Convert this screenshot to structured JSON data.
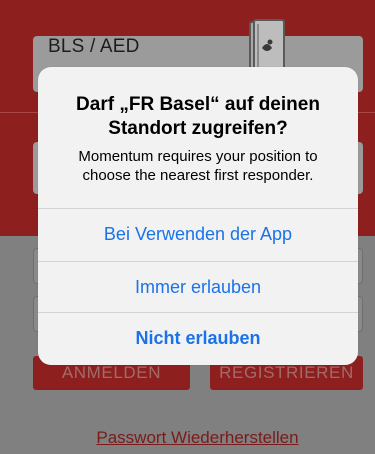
{
  "background": {
    "course_tile_label": "BLS / AED",
    "login_button": "ANMELDEN",
    "register_button": "REGISTRIEREN",
    "forgot_link": "Passwort Wiederherstellen",
    "colors": {
      "header_red": "#8e1f1f",
      "dim_overlay": "#808080"
    }
  },
  "alert": {
    "title": "Darf „FR Basel“ auf deinen Standort zugreifen?",
    "message": "Momentum requires your position to choose the nearest first responder.",
    "actions": [
      {
        "label": "Bei Verwenden der App"
      },
      {
        "label": "Immer erlauben"
      },
      {
        "label": "Nicht erlauben"
      }
    ],
    "colors": {
      "action_blue": "#1a73e8",
      "alert_bg": "#f2f2f2"
    }
  },
  "icons": {
    "book": "book-icon"
  }
}
